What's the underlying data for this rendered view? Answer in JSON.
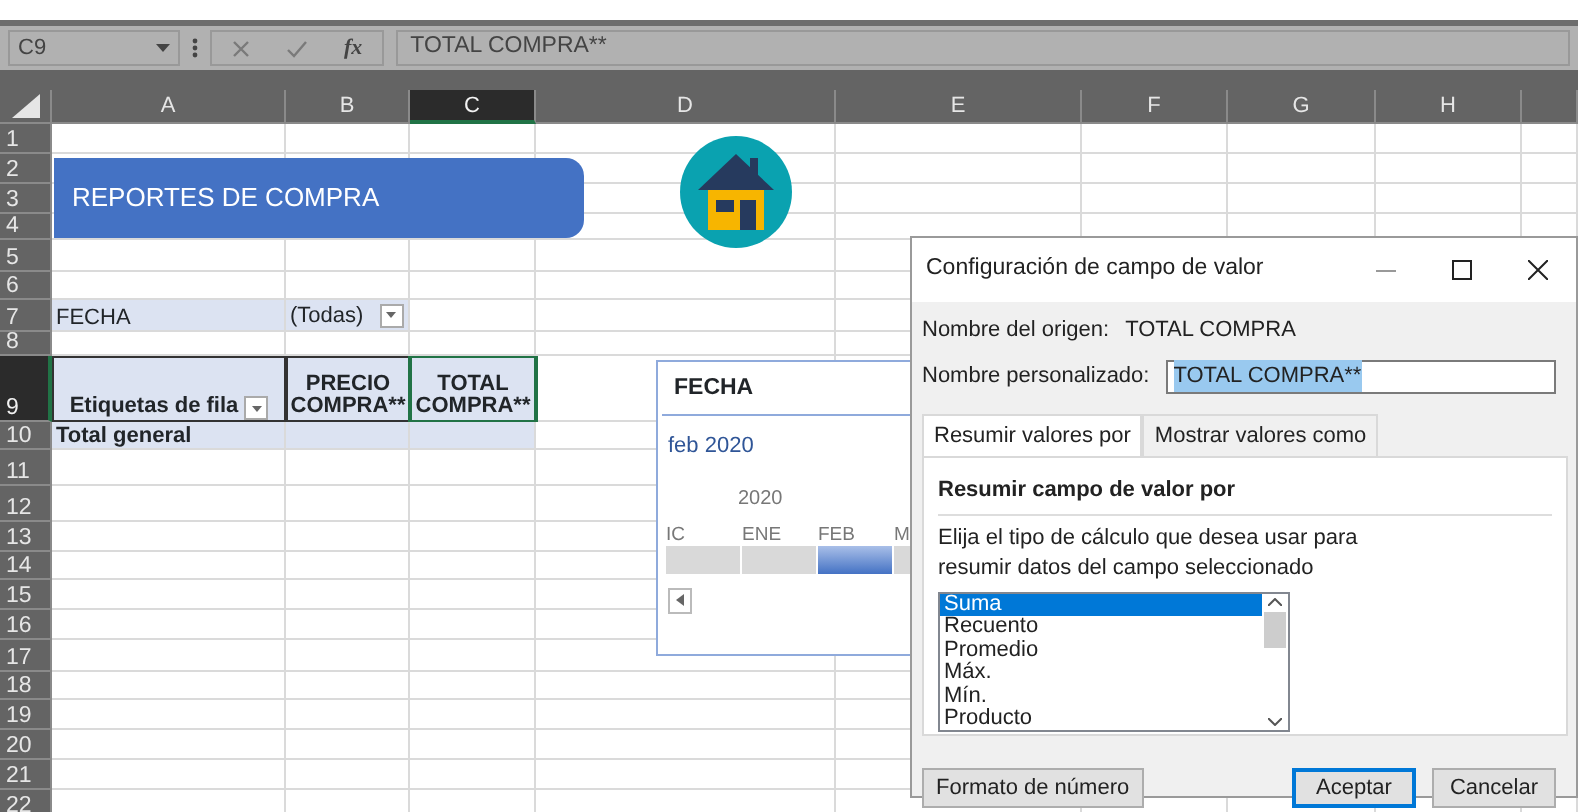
{
  "formula_bar": {
    "name_box": "C9",
    "function_label": "fx",
    "formula": "TOTAL COMPRA**"
  },
  "columns": [
    {
      "label": "A",
      "selected": false
    },
    {
      "label": "B",
      "selected": false
    },
    {
      "label": "C",
      "selected": true
    },
    {
      "label": "D",
      "selected": false
    },
    {
      "label": "E",
      "selected": false
    },
    {
      "label": "F",
      "selected": false
    },
    {
      "label": "G",
      "selected": false
    },
    {
      "label": "H",
      "selected": false
    }
  ],
  "rows": [
    {
      "label": "1",
      "selected": false
    },
    {
      "label": "2",
      "selected": false
    },
    {
      "label": "3",
      "selected": false
    },
    {
      "label": "4",
      "selected": false
    },
    {
      "label": "5",
      "selected": false
    },
    {
      "label": "6",
      "selected": false
    },
    {
      "label": "7",
      "selected": false
    },
    {
      "label": "8",
      "selected": false
    },
    {
      "label": "9",
      "selected": true
    },
    {
      "label": "10",
      "selected": false
    },
    {
      "label": "11",
      "selected": false
    },
    {
      "label": "12",
      "selected": false
    },
    {
      "label": "13",
      "selected": false
    },
    {
      "label": "14",
      "selected": false
    },
    {
      "label": "15",
      "selected": false
    },
    {
      "label": "16",
      "selected": false
    },
    {
      "label": "17",
      "selected": false
    },
    {
      "label": "18",
      "selected": false
    },
    {
      "label": "19",
      "selected": false
    },
    {
      "label": "20",
      "selected": false
    },
    {
      "label": "21",
      "selected": false
    },
    {
      "label": "22",
      "selected": false
    }
  ],
  "banner": {
    "title": "REPORTES DE COMPRA"
  },
  "pivot_table": {
    "filter_field": "FECHA",
    "filter_value": "(Todas)",
    "headers": [
      "Etiquetas de fila",
      "PRECIO COMPRA**",
      "TOTAL COMPRA**"
    ],
    "total_label": "Total general"
  },
  "slicer": {
    "title": "FECHA",
    "selection": "feb 2020",
    "year": "2020",
    "months": [
      {
        "label": "IC",
        "selected": false
      },
      {
        "label": "ENE",
        "selected": false
      },
      {
        "label": "FEB",
        "selected": true
      },
      {
        "label": "M",
        "selected": false
      }
    ]
  },
  "dialog": {
    "title": "Configuración de campo de valor",
    "source_label": "Nombre del origen:",
    "source_value": "TOTAL COMPRA",
    "custom_label": "Nombre personalizado:",
    "custom_value": "TOTAL COMPRA**",
    "tabs": [
      {
        "label": "Resumir valores por",
        "selected": true
      },
      {
        "label": "Mostrar valores como",
        "selected": false
      }
    ],
    "section_title": "Resumir campo de valor por",
    "description": "Elija el tipo de cálculo que desea usar para resumir datos del campo seleccionado",
    "functions": [
      {
        "label": "Suma",
        "selected": true
      },
      {
        "label": "Recuento",
        "selected": false
      },
      {
        "label": "Promedio",
        "selected": false
      },
      {
        "label": "Máx.",
        "selected": false
      },
      {
        "label": "Mín.",
        "selected": false
      },
      {
        "label": "Producto",
        "selected": false
      }
    ],
    "buttons": [
      {
        "label": "Formato de número",
        "kind": "secondary"
      },
      {
        "label": "Aceptar",
        "kind": "default"
      },
      {
        "label": "Cancelar",
        "kind": "secondary"
      }
    ]
  }
}
